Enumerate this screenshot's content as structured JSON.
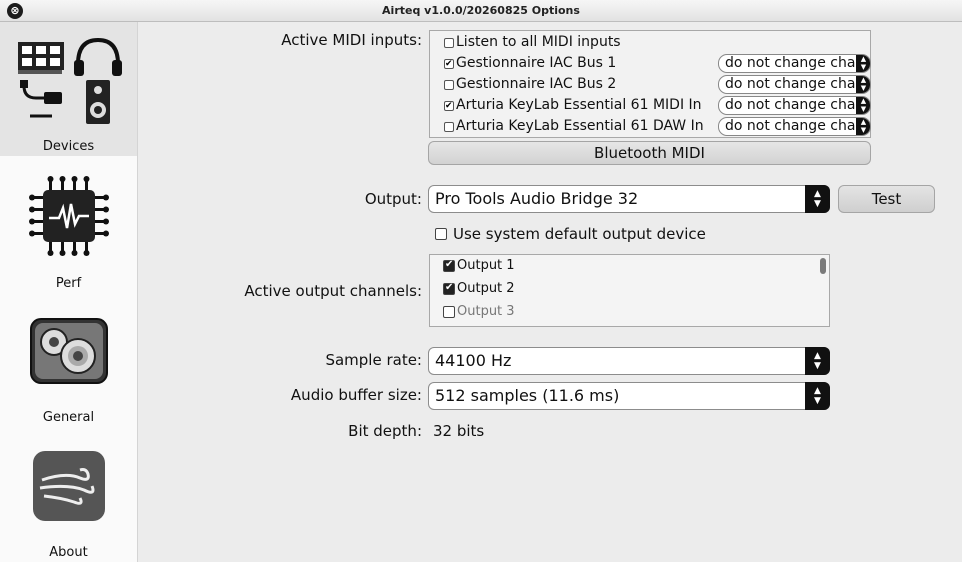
{
  "window": {
    "title": "Airteq v1.0.0/20260825 Options",
    "close_glyph": "⊗"
  },
  "sidebar": {
    "items": [
      {
        "label": "Devices",
        "icon": "devices-icon",
        "active": true
      },
      {
        "label": "Perf",
        "icon": "chip-icon",
        "active": false
      },
      {
        "label": "General",
        "icon": "gears-icon",
        "active": false
      },
      {
        "label": "About",
        "icon": "wind-icon",
        "active": false
      }
    ]
  },
  "midi": {
    "label": "Active MIDI inputs:",
    "listen_all": {
      "label": "Listen to all MIDI inputs",
      "checked": false
    },
    "inputs": [
      {
        "name": "Gestionnaire IAC Bus 1",
        "checked": true,
        "channel": "do not change channel"
      },
      {
        "name": "Gestionnaire IAC Bus 2",
        "checked": false,
        "channel": "do not change channel"
      },
      {
        "name": "Arturia KeyLab Essential 61 MIDI In",
        "checked": true,
        "channel": "do not change channel"
      },
      {
        "name": "Arturia KeyLab Essential 61 DAW In",
        "checked": false,
        "channel": "do not change channel"
      }
    ],
    "bluetooth_button": "Bluetooth MIDI"
  },
  "output": {
    "label": "Output:",
    "value": "Pro Tools Audio Bridge 32",
    "test_button": "Test",
    "system_default": {
      "label": "Use system default output device",
      "checked": false
    }
  },
  "channels": {
    "label": "Active output channels:",
    "items": [
      {
        "name": "Output 1",
        "checked": true
      },
      {
        "name": "Output 2",
        "checked": true
      },
      {
        "name": "Output 3",
        "checked": false
      }
    ]
  },
  "sample_rate": {
    "label": "Sample rate:",
    "value": "44100 Hz"
  },
  "buffer": {
    "label": "Audio buffer size:",
    "value": "512 samples (11.6 ms)"
  },
  "bit_depth": {
    "label": "Bit depth:",
    "value": "32 bits"
  }
}
